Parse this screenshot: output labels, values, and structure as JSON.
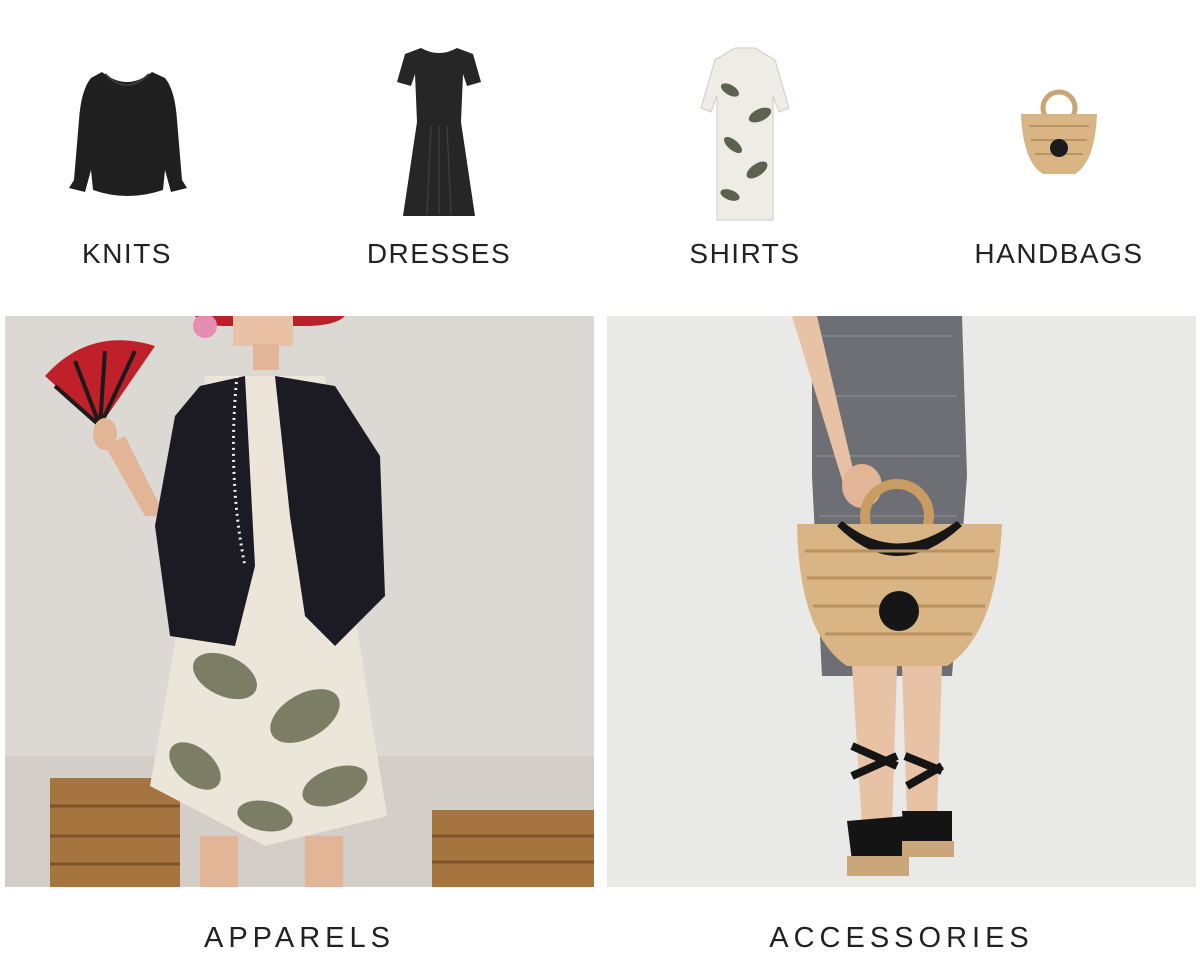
{
  "categories": [
    {
      "label": "KNITS",
      "icon": "knit-top-icon"
    },
    {
      "label": "DRESSES",
      "icon": "dress-icon"
    },
    {
      "label": "SHIRTS",
      "icon": "shirt-dress-icon"
    },
    {
      "label": "HANDBAGS",
      "icon": "straw-handbag-icon"
    }
  ],
  "banners": [
    {
      "label": "APPARELS"
    },
    {
      "label": "ACCESSORIES"
    }
  ],
  "colors": {
    "text": "#222222",
    "background": "#ffffff",
    "knit_black": "#1f1f1f",
    "straw": "#d9b585",
    "fan_red": "#c0202a"
  }
}
